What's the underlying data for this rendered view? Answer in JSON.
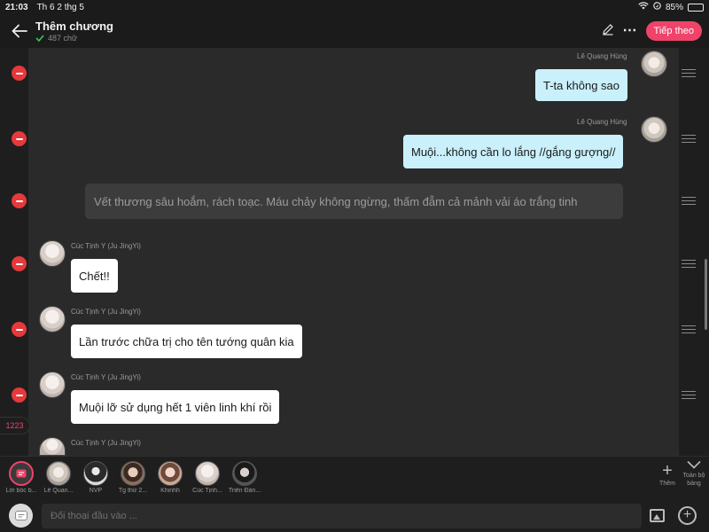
{
  "status": {
    "time": "21:03",
    "date": "Th 6 2 thg 5",
    "battery": "85%",
    "battery_level": 0.85
  },
  "header": {
    "title": "Thêm chương",
    "word_count": "487 chữ",
    "next_label": "Tiếp theo",
    "more_icon": "⋯"
  },
  "messages": [
    {
      "side": "right",
      "name": "Lê Quang Hùng",
      "text": "T-ta không sao"
    },
    {
      "side": "right",
      "name": "Lê Quang Hùng",
      "text": "Muội...không cần lo lắng //gắng gượng//"
    },
    {
      "side": "narration",
      "text": "Vết thương sâu hoắm, rách toạc. Máu chảy không ngừng, thấm đẫm cả mảnh vải áo trắng tinh"
    },
    {
      "side": "left",
      "name": "Cúc Tịnh Y (Ju JingYi)",
      "text": "Chết!!"
    },
    {
      "side": "left",
      "name": "Cúc Tịnh Y (Ju JingYi)",
      "text": "Lần trước chữa trị cho tên tướng quân kia"
    },
    {
      "side": "left",
      "name": "Cúc Tịnh Y (Ju JingYi)",
      "text": "Muội lỡ sử dụng hết 1 viên linh khí rồi"
    },
    {
      "side": "left",
      "name": "Cúc Tịnh Y (Ju JingYi)",
      "text": ""
    }
  ],
  "count_badge": "1223",
  "characters": [
    {
      "label": "Lời bốc b..."
    },
    {
      "label": "Lê Quan..."
    },
    {
      "label": "NVP"
    },
    {
      "label": "Tg thứ 2..."
    },
    {
      "label": "Khinhh"
    },
    {
      "label": "Cúc Tịnh..."
    },
    {
      "label": "Triển Đán..."
    }
  ],
  "add_label": "Thêm",
  "all_label": "Toàn bộ bảng",
  "input": {
    "placeholder": "Đối thoại đầu vào ..."
  }
}
